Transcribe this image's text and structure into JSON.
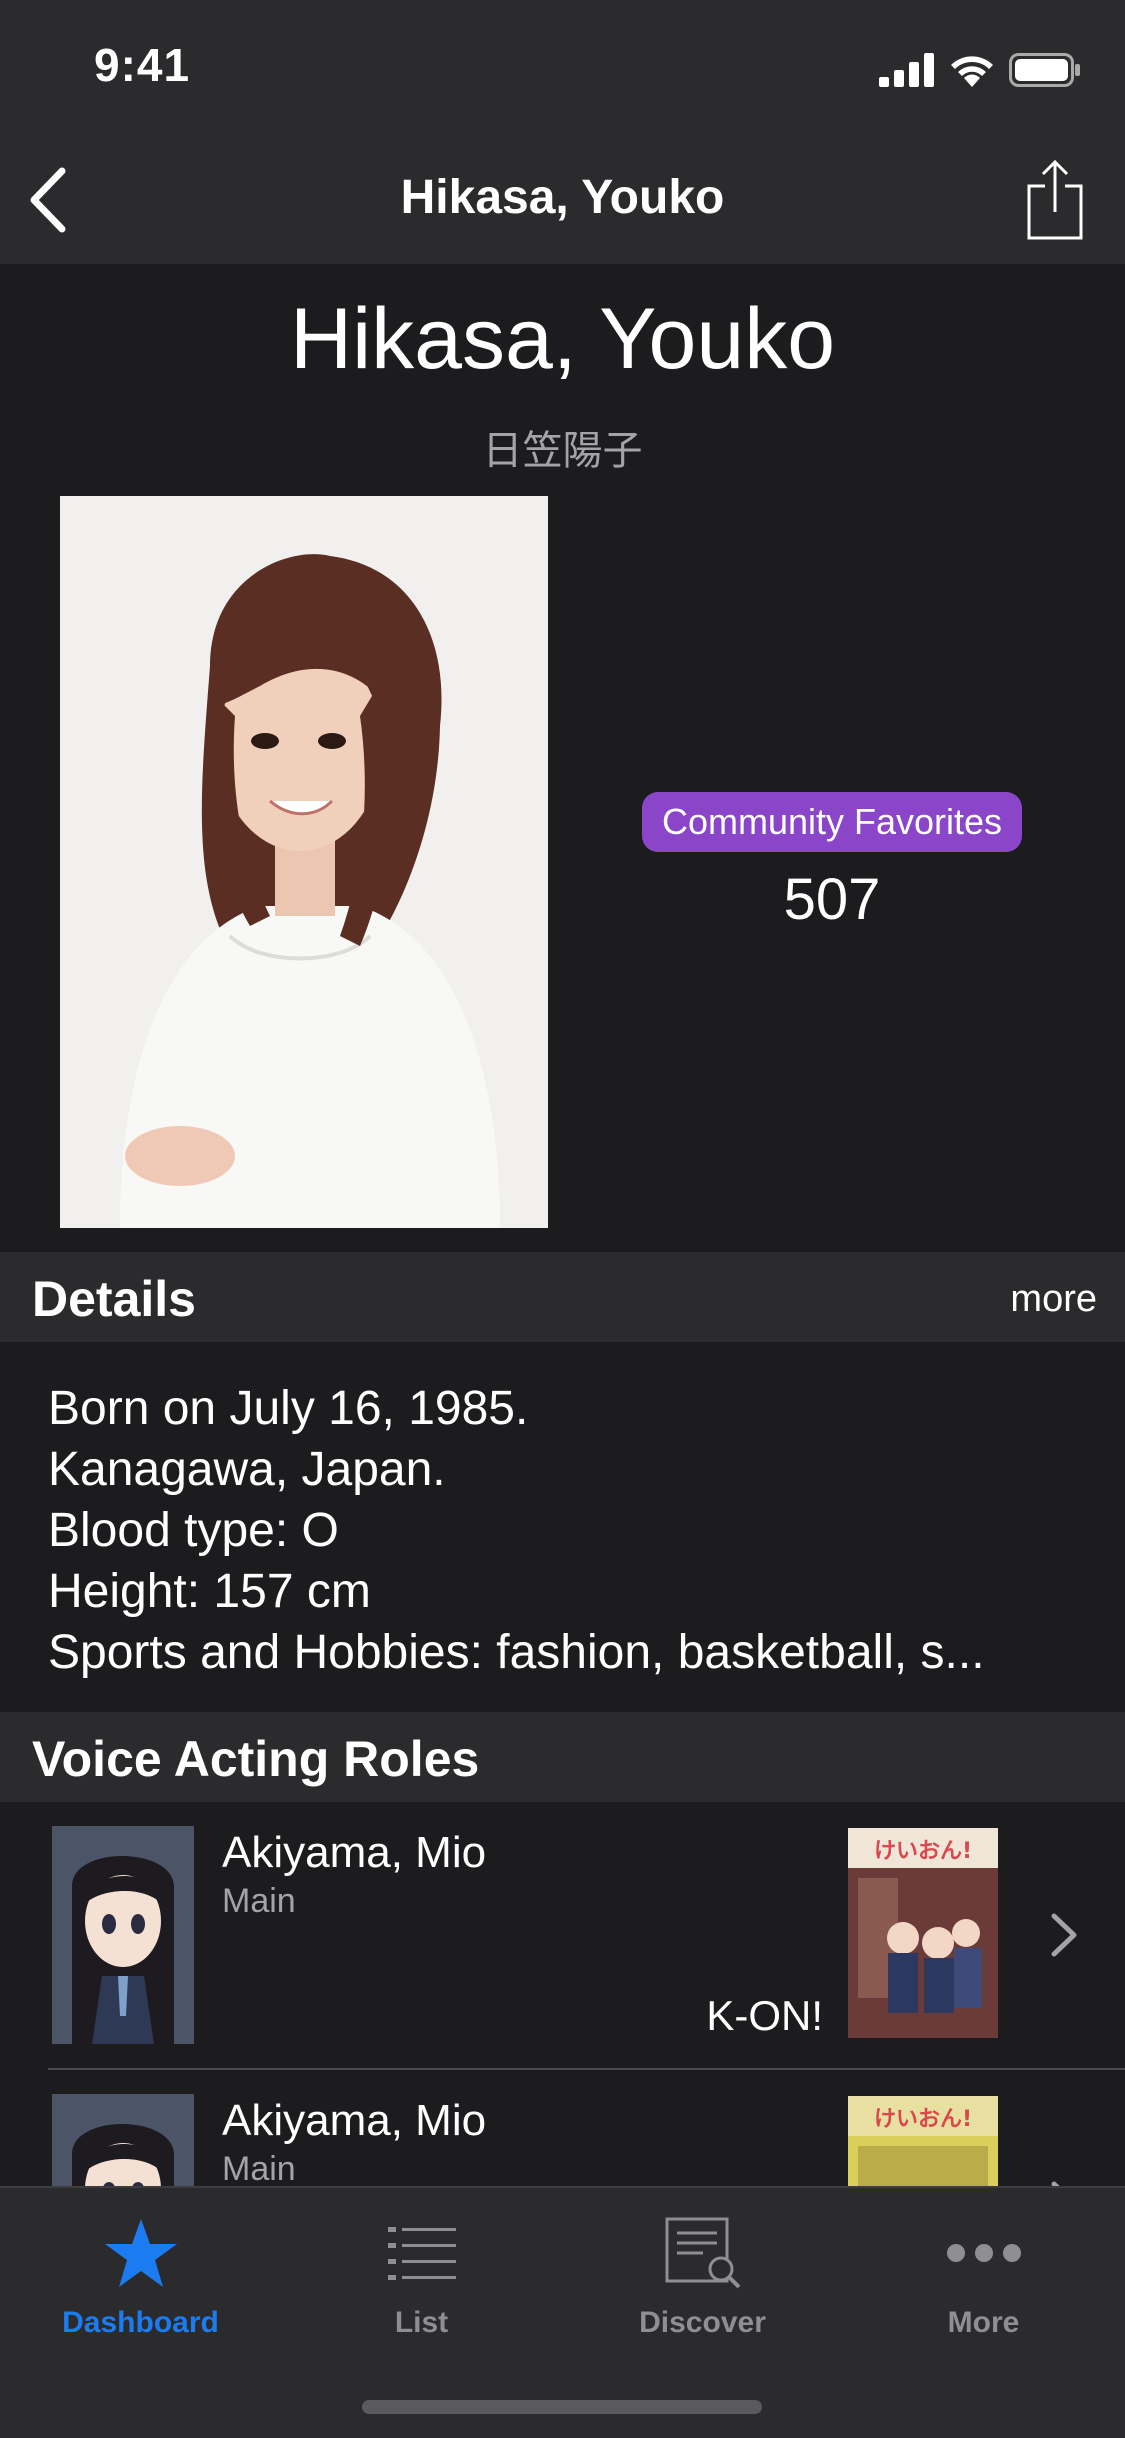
{
  "status_bar": {
    "time": "9:41"
  },
  "nav": {
    "title": "Hikasa, Youko"
  },
  "header": {
    "name": "Hikasa, Youko",
    "native_name": "日笠陽子",
    "favorites_label": "Community Favorites",
    "favorites_count": "507"
  },
  "details": {
    "title": "Details",
    "more_label": "more",
    "lines": [
      "Born on July 16, 1985.",
      "Kanagawa, Japan.",
      "Blood type: O",
      "Height: 157 cm",
      "Sports and Hobbies: fashion, basketball, s..."
    ]
  },
  "roles": {
    "title": "Voice Acting Roles",
    "items": [
      {
        "character": "Akiyama, Mio",
        "role": "Main",
        "anime": "K-ON!"
      },
      {
        "character": "Akiyama, Mio",
        "role": "Main",
        "anime": ""
      }
    ]
  },
  "tabbar": {
    "tabs": [
      {
        "label": "Dashboard",
        "icon": "star-icon",
        "active": true
      },
      {
        "label": "List",
        "icon": "list-icon",
        "active": false
      },
      {
        "label": "Discover",
        "icon": "discover-icon",
        "active": false
      },
      {
        "label": "More",
        "icon": "more-icon",
        "active": false
      }
    ]
  },
  "colors": {
    "accent": "#1b7cf2",
    "badge": "#8a45c9",
    "background": "#1c1c1e",
    "bar": "#2b2b2d"
  }
}
